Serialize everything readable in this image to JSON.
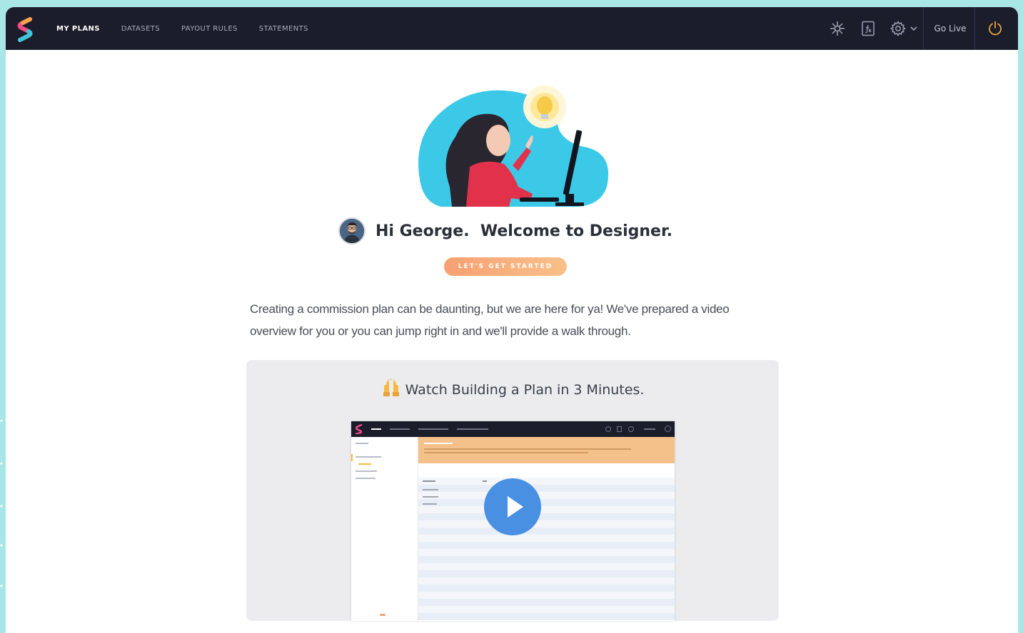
{
  "nav": {
    "items": [
      {
        "label": "MY PLANS",
        "active": true
      },
      {
        "label": "DATASETS",
        "active": false
      },
      {
        "label": "PAYOUT RULES",
        "active": false
      },
      {
        "label": "STATEMENTS",
        "active": false
      }
    ]
  },
  "toolbar": {
    "icons": [
      "network-icon",
      "formula-icon",
      "gear-icon",
      "chevron-down-icon",
      "power-icon"
    ],
    "go_live_label": "Go Live"
  },
  "welcome": {
    "greeting": "Hi George.  Welcome to Designer.",
    "cta_label": "LET'S GET STARTED",
    "intro_text": "Creating a commission plan can be daunting, but we are here for ya!  We've prepared a video overview for you or you can jump right in and we'll provide a walk through."
  },
  "video": {
    "title": "Watch Building a Plan in 3 Minutes."
  },
  "colors": {
    "topbar": "#1b1d2b",
    "page_bg": "#a9e6e6",
    "cta_start": "#f7a072",
    "cta_end": "#f8c08a",
    "play": "#4a90e2",
    "power": "#e8a33d"
  }
}
